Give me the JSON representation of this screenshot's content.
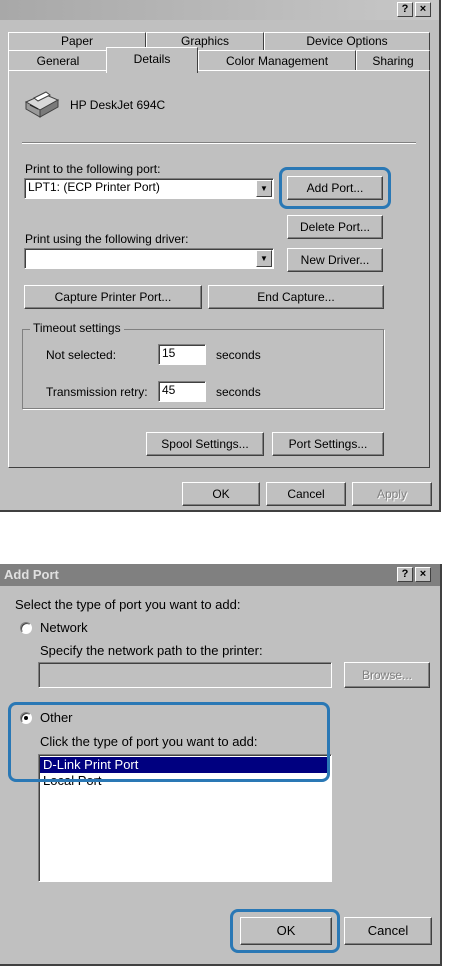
{
  "props": {
    "titlebar": {
      "help": "?",
      "close": "×"
    },
    "tabs_back": [
      "Paper",
      "Graphics",
      "Device Options"
    ],
    "tabs_front": [
      "General",
      "Details",
      "Color Management",
      "Sharing"
    ],
    "printer_name": "HP DeskJet 694C",
    "print_to_label": "Print to the following port:",
    "port_value": "LPT1:  (ECP Printer Port)",
    "add_port": "Add Port...",
    "delete_port": "Delete Port...",
    "driver_label": "Print using the following driver:",
    "driver_value": "",
    "new_driver": "New Driver...",
    "capture": "Capture Printer Port...",
    "end_capture": "End Capture...",
    "timeout_title": "Timeout settings",
    "not_selected_label": "Not selected:",
    "not_selected_value": "15",
    "retry_label": "Transmission retry:",
    "retry_value": "45",
    "seconds": "seconds",
    "spool": "Spool Settings...",
    "port_settings": "Port Settings...",
    "ok": "OK",
    "cancel": "Cancel",
    "apply": "Apply"
  },
  "addport": {
    "title": "Add Port",
    "titlebar": {
      "help": "?",
      "close": "×"
    },
    "prompt": "Select the type of port you want to add:",
    "network_label": "Network",
    "network_sub": "Specify the network path to the printer:",
    "network_path": "",
    "browse": "Browse...",
    "other_label": "Other",
    "other_sub": "Click the type of port you want to add:",
    "port_types": [
      "D-Link Print Port",
      "Local Port"
    ],
    "selected_index": 0,
    "ok": "OK",
    "cancel": "Cancel"
  },
  "colors": {
    "highlight": "#2a78b5",
    "selection": "#000080",
    "titlebar": "#808080"
  }
}
